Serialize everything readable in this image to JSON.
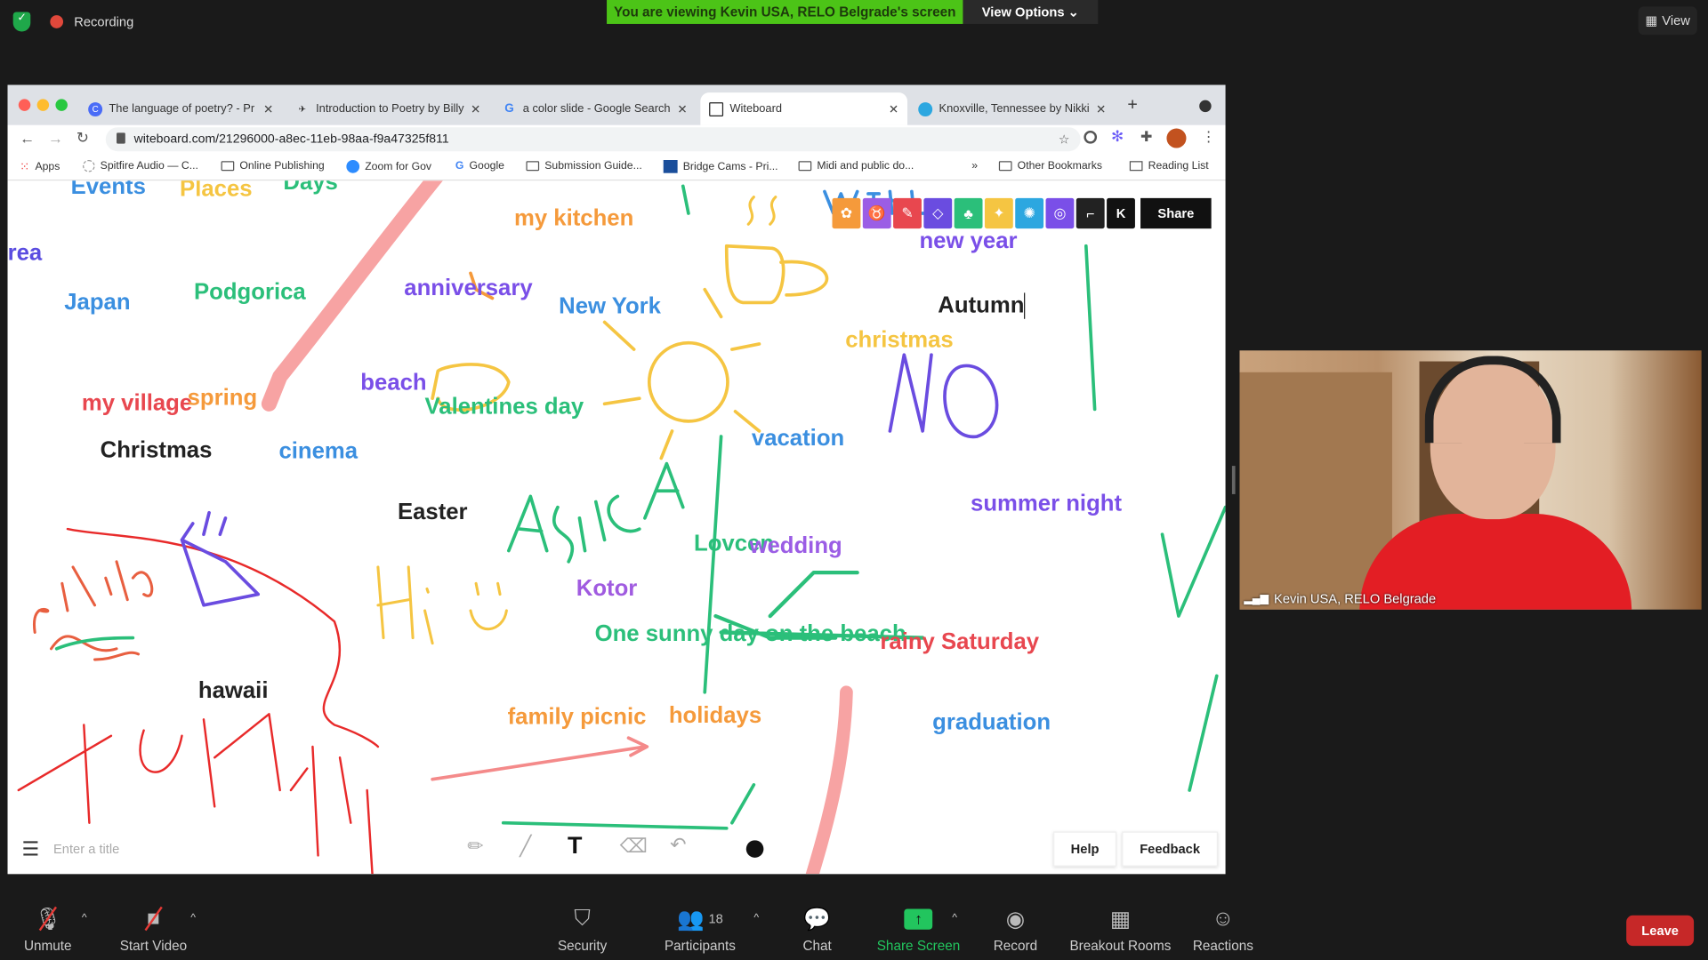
{
  "meeting": {
    "recording_label": "Recording",
    "banner": "You are viewing Kevin USA, RELO Belgrade's screen",
    "view_options": "View Options",
    "view": "View"
  },
  "browser": {
    "tabs": [
      {
        "title": "The language of poetry? - Pr"
      },
      {
        "title": "Introduction to Poetry by Billy"
      },
      {
        "title": "a color slide - Google Search"
      },
      {
        "title": "Witeboard"
      },
      {
        "title": "Knoxville, Tennessee by Nikki"
      }
    ],
    "url": "witeboard.com/21296000-a8ec-11eb-98aa-f9a47325f811",
    "bookmarks": [
      "Apps",
      "Spitfire Audio — C...",
      "Online Publishing",
      "Zoom for Gov",
      "Google",
      "Submission Guide...",
      "Bridge Cams - Pri...",
      "Midi and public do..."
    ],
    "more": "»",
    "other_bookmarks": "Other Bookmarks",
    "reading_list": "Reading List"
  },
  "whiteboard": {
    "words": [
      {
        "text": "Events",
        "color": "#3b8fe0"
      },
      {
        "text": "Places",
        "color": "#f5c542"
      },
      {
        "text": "Days",
        "color": "#2bbf7a"
      },
      {
        "text": "rea",
        "color": "#5a4ce0"
      },
      {
        "text": "my kitchen",
        "color": "#f59a3b"
      },
      {
        "text": "new year",
        "color": "#7a4fe8"
      },
      {
        "text": "Japan",
        "color": "#3b8fe0"
      },
      {
        "text": "Podgorica",
        "color": "#2bbf7a"
      },
      {
        "text": "anniversary",
        "color": "#7a4fe8"
      },
      {
        "text": "New York",
        "color": "#3b8fe0"
      },
      {
        "text": "Autumn",
        "color": "#222222"
      },
      {
        "text": "christmas",
        "color": "#f5c542"
      },
      {
        "text": "beach",
        "color": "#7a4fe8"
      },
      {
        "text": "my village",
        "color": "#e8474f"
      },
      {
        "text": "spring",
        "color": "#f59a3b"
      },
      {
        "text": "Valentines day",
        "color": "#2bbf7a"
      },
      {
        "text": "vacation",
        "color": "#3b8fe0"
      },
      {
        "text": "Christmas",
        "color": "#222222"
      },
      {
        "text": "cinema",
        "color": "#3b8fe0"
      },
      {
        "text": "Easter",
        "color": "#222222"
      },
      {
        "text": "summer night",
        "color": "#7a4fe8"
      },
      {
        "text": "Lovcen",
        "color": "#2bbf7a"
      },
      {
        "text": "wedding",
        "color": "#9b5de5"
      },
      {
        "text": "Kotor",
        "color": "#a05be0"
      },
      {
        "text": "One sunny day on the beach",
        "color": "#2bbf7a"
      },
      {
        "text": "rainy Saturday",
        "color": "#e8474f"
      },
      {
        "text": "hawaii",
        "color": "#222222"
      },
      {
        "text": "family picnic",
        "color": "#f59a3b"
      },
      {
        "text": "holidays",
        "color": "#f59a3b"
      },
      {
        "text": "graduation",
        "color": "#3b8fe0"
      }
    ],
    "user_initial": "K",
    "share": "Share",
    "title_placeholder": "Enter a title",
    "help": "Help",
    "feedback": "Feedback"
  },
  "video": {
    "participant": "Kevin USA, RELO Belgrade"
  },
  "toolbar": {
    "unmute": "Unmute",
    "start_video": "Start Video",
    "security": "Security",
    "participants": "Participants",
    "participant_count": "18",
    "chat": "Chat",
    "share_screen": "Share Screen",
    "record": "Record",
    "breakout_rooms": "Breakout Rooms",
    "reactions": "Reactions",
    "leave": "Leave"
  },
  "colors": {
    "banner": "#4cc417",
    "share_screen": "#22c55e",
    "leave": "#c62828"
  }
}
